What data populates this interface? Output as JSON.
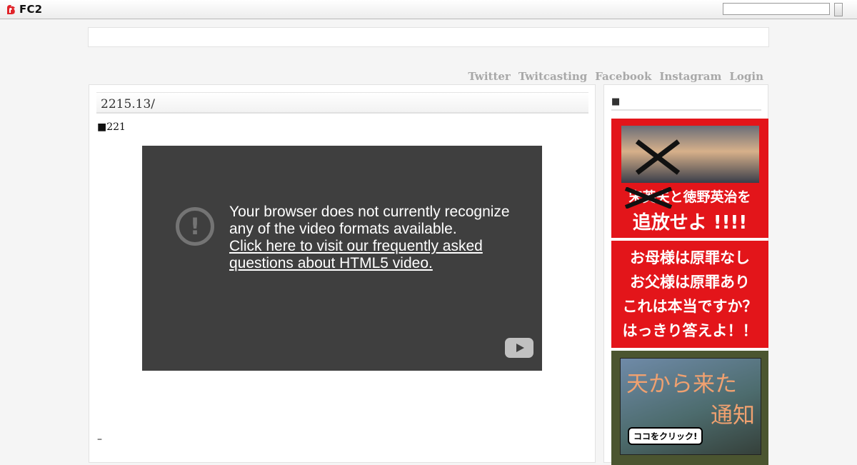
{
  "topbar": {
    "logo_text": "FC2",
    "search": {
      "value": "",
      "placeholder": ""
    }
  },
  "nav": {
    "links": [
      "Twitter",
      "Twitcasting",
      "Facebook",
      "Instagram",
      "Login"
    ]
  },
  "post": {
    "title": "2215.13/",
    "body": "■221",
    "footer": "–"
  },
  "video": {
    "message": "Your browser does not currently recognize any of the video formats available.",
    "link": "Click here to visit our frequently asked questions about HTML5 video.",
    "alert_icon": "!"
  },
  "sidebar": {
    "heading": "■",
    "banners": [
      {
        "text_lines": [
          "宋英夫と徳野英治を",
          "追放せよ !!!!"
        ]
      },
      {
        "text_lines": [
          "お母様は原罪なし",
          "お父様は原罪あり",
          "これは本当ですか？",
          "はっきり答えよ！！"
        ]
      },
      {
        "text_lines": [
          "天から来た",
          "通知"
        ],
        "button": "ココをクリック!"
      }
    ]
  },
  "colors": {
    "banner_red": "#e3151a",
    "video_bg": "#3f3f3f",
    "nav_link": "#a8a8a8"
  }
}
